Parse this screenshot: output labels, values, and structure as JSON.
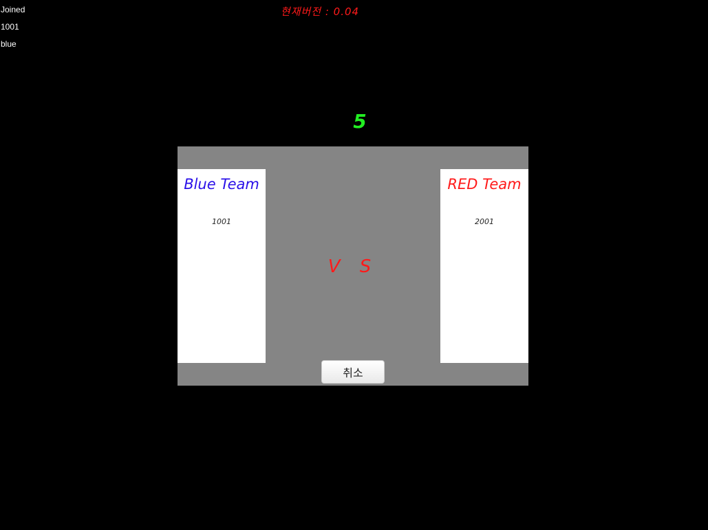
{
  "debug": {
    "status": "Joined",
    "user_id": "1001",
    "team": "blue"
  },
  "header": {
    "version_text": "현재버전 : 0.04"
  },
  "match": {
    "countdown": "5",
    "vs_text": "V S",
    "blue_team": {
      "name": "Blue Team",
      "members": [
        "1001"
      ],
      "color": "#2a10e8"
    },
    "red_team": {
      "name": "RED Team",
      "members": [
        "2001"
      ],
      "color": "#ff1a1a"
    },
    "cancel_label": "취소"
  },
  "colors": {
    "background": "#000000",
    "panel": "#858585",
    "countdown": "#22ee22",
    "accent_red": "#ff1a1a"
  }
}
